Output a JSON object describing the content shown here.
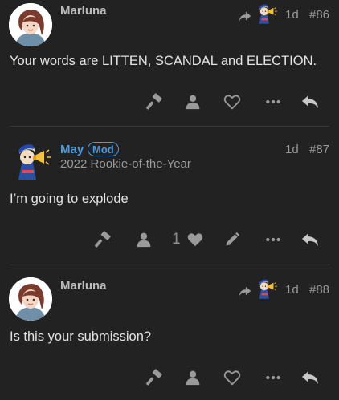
{
  "colors": {
    "background": "#222222",
    "mod_blue": "#4f9bdc",
    "icon_gray": "#9a9a9a"
  },
  "posts": [
    {
      "username": "Marluna",
      "date": "1d",
      "number": "#86",
      "content": "Your words are LITTEN, SCANDAL and ELECTION.",
      "reply_to_avatar": "may-avatar",
      "actions": [
        "hammer-icon",
        "user-icon",
        "heart-outline-icon",
        "ellipsis-icon",
        "reply-icon"
      ]
    },
    {
      "username": "May",
      "badge": "Mod",
      "user_title": "2022 Rookie-of-the-Year",
      "date": "1d",
      "number": "#87",
      "content": "I’m going to explode",
      "like_count": "1",
      "actions": [
        "hammer-icon",
        "user-icon",
        "heart-filled-icon",
        "pencil-icon",
        "ellipsis-icon",
        "reply-icon"
      ]
    },
    {
      "username": "Marluna",
      "date": "1d",
      "number": "#88",
      "content": "Is this your submission?",
      "reply_to_avatar": "may-avatar",
      "actions": [
        "hammer-icon",
        "user-icon",
        "heart-outline-icon",
        "ellipsis-icon",
        "reply-icon"
      ]
    }
  ]
}
